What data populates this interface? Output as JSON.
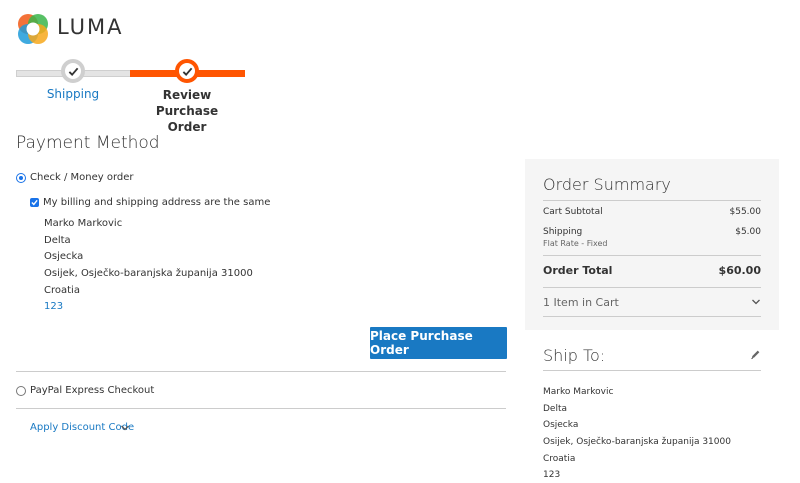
{
  "brand": {
    "name": "LUMA"
  },
  "progress": {
    "steps": [
      {
        "label": "Shipping",
        "state": "complete"
      },
      {
        "label": "Review Purchase Order",
        "state": "active"
      }
    ],
    "colors": {
      "active": "#ff5501",
      "inactive": "#e4e4e4"
    }
  },
  "payment": {
    "title": "Payment Method",
    "methods": [
      {
        "label": "Check / Money order",
        "selected": true
      },
      {
        "label": "PayPal Express Checkout",
        "selected": false
      }
    ],
    "billing_same_label": "My billing and shipping address are the same",
    "billing_address": {
      "name": "Marko Markovic",
      "company": "Delta",
      "street": "Osjecka",
      "city_region_zip": "Osijek, Osječko-baranjska županija 31000",
      "country": "Croatia",
      "phone": "123"
    },
    "place_order_label": "Place Purchase Order",
    "discount_label": "Apply Discount Code"
  },
  "summary": {
    "title": "Order Summary",
    "subtotal_label": "Cart Subtotal",
    "subtotal_value": "$55.00",
    "shipping_label": "Shipping",
    "shipping_method": "Flat Rate - Fixed",
    "shipping_value": "$5.00",
    "total_label": "Order Total",
    "total_value": "$60.00",
    "items_in_cart": "1 Item in Cart"
  },
  "ship_to": {
    "title": "Ship To:",
    "name": "Marko Markovic",
    "company": "Delta",
    "street": "Osjecka",
    "city_region_zip": "Osijek, Osječko-baranjska županija 31000",
    "country": "Croatia",
    "phone": "123"
  },
  "colors": {
    "link": "#1979c3",
    "button": "#1979c3",
    "progress_active": "#ff5501",
    "summary_bg": "#f5f5f5"
  },
  "icons": [
    "luma-logo-icon",
    "check-icon",
    "chevron-down-icon",
    "pencil-icon"
  ]
}
